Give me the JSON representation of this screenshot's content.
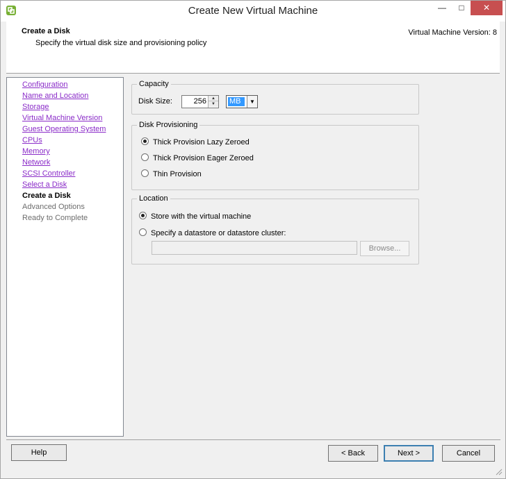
{
  "window": {
    "title": "Create New Virtual Machine",
    "minimize_glyph": "—",
    "maximize_glyph": "□",
    "close_glyph": "✕"
  },
  "header": {
    "title": "Create a Disk",
    "subtitle": "Specify the virtual disk size and provisioning policy",
    "version": "Virtual Machine Version: 8"
  },
  "nav": {
    "items": [
      {
        "label": "Configuration",
        "state": "link"
      },
      {
        "label": "Name and Location",
        "state": "link"
      },
      {
        "label": "Storage",
        "state": "link"
      },
      {
        "label": "Virtual Machine Version",
        "state": "link"
      },
      {
        "label": "Guest Operating System",
        "state": "link"
      },
      {
        "label": "CPUs",
        "state": "link"
      },
      {
        "label": "Memory",
        "state": "link"
      },
      {
        "label": "Network",
        "state": "link"
      },
      {
        "label": "SCSI Controller",
        "state": "link"
      },
      {
        "label": "Select a Disk",
        "state": "link"
      },
      {
        "label": "Create a Disk",
        "state": "current"
      },
      {
        "label": "Advanced Options",
        "state": "disabled"
      },
      {
        "label": "Ready to Complete",
        "state": "disabled"
      }
    ]
  },
  "capacity": {
    "title": "Capacity",
    "disk_size_label": "Disk Size:",
    "disk_size_value": "256",
    "unit_selected": "MB"
  },
  "provisioning": {
    "title": "Disk Provisioning",
    "options": [
      {
        "label": "Thick Provision Lazy Zeroed",
        "checked": true
      },
      {
        "label": "Thick Provision Eager Zeroed",
        "checked": false
      },
      {
        "label": "Thin Provision",
        "checked": false
      }
    ]
  },
  "location": {
    "title": "Location",
    "options": [
      {
        "label": "Store with the virtual machine",
        "checked": true
      },
      {
        "label": "Specify a datastore or datastore cluster:",
        "checked": false
      }
    ],
    "path_value": "",
    "browse_label": "Browse..."
  },
  "footer": {
    "help_label": "Help",
    "back_label": "< Back",
    "next_label": "Next >",
    "cancel_label": "Cancel"
  },
  "colors": {
    "link": "#8a2bc8",
    "close_button": "#c74f50",
    "selection": "#3399ff",
    "default_button_border": "#3c7fb1"
  }
}
